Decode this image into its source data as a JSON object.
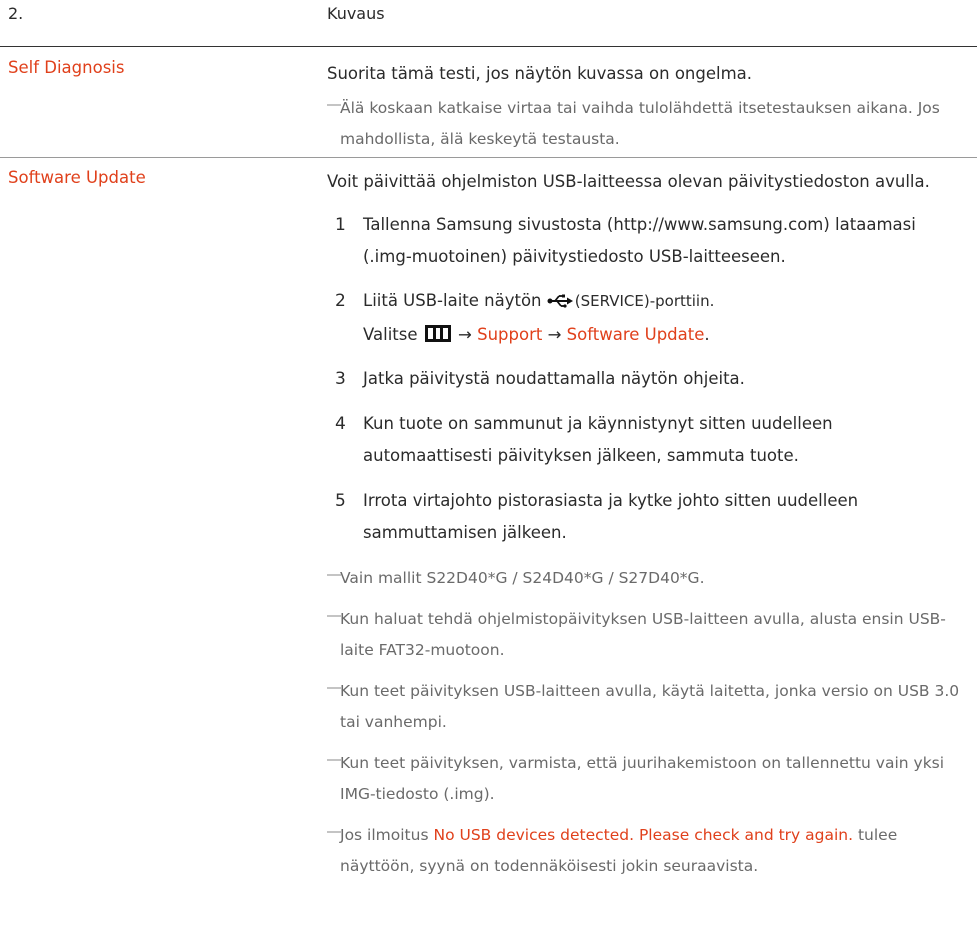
{
  "header": {
    "number": "2.",
    "column": "Kuvaus"
  },
  "self_diagnosis": {
    "label": "Self Diagnosis",
    "text": "Suorita tämä testi, jos näytön kuvassa on ongelma.",
    "note": "Älä koskaan katkaise virtaa tai vaihda tulolähdettä itsetestauksen aikana. Jos mahdollista, älä keskeytä testausta."
  },
  "software_update": {
    "label": "Software Update",
    "intro": "Voit päivittää ohjelmiston USB-laitteessa olevan päivitystiedoston avulla.",
    "steps": [
      {
        "num": "1",
        "text": "Tallenna Samsung sivustosta (http://www.samsung.com) lataamasi (.img-muotoinen) päivitystiedosto USB-laitteeseen."
      },
      {
        "num": "2",
        "prefix": "Liitä USB-laite näytön",
        "service": "(SERVICE)-porttiin.",
        "line2_prefix": "Valitse",
        "arrow": "→",
        "support": "Support",
        "software_update": "Software Update",
        "period": "."
      },
      {
        "num": "3",
        "text": "Jatka päivitystä noudattamalla näytön ohjeita."
      },
      {
        "num": "4",
        "text": "Kun tuote on sammunut ja käynnistynyt sitten uudelleen automaattisesti päivityksen jälkeen, sammuta tuote."
      },
      {
        "num": "5",
        "text": "Irrota virtajohto pistorasiasta ja kytke johto sitten uudelleen sammuttamisen jälkeen."
      }
    ],
    "notes": [
      "Vain mallit S22D40*G / S24D40*G / S27D40*G.",
      "Kun haluat tehdä ohjelmistopäivityksen USB-laitteen avulla, alusta ensin USB-laite FAT32-muotoon.",
      "Kun teet päivityksen USB-laitteen avulla, käytä laitetta, jonka versio on USB 3.0 tai vanhempi.",
      "Kun teet päivityksen, varmista, että juurihakemistoon on tallennettu vain yksi IMG-tiedosto (.img)."
    ],
    "last_note": {
      "prefix": "Jos ilmoitus",
      "message": "No USB devices detected. Please check and try again.",
      "suffix": "tulee näyttöön, syynä on todennäköisesti jokin seuraavista."
    }
  },
  "note_marker": "―",
  "icons": {
    "usb": "usb-icon",
    "menu": "menu-icon"
  },
  "colors": {
    "accent": "#e0401b",
    "text": "#2b2b2b",
    "note": "#6a6a6a"
  }
}
